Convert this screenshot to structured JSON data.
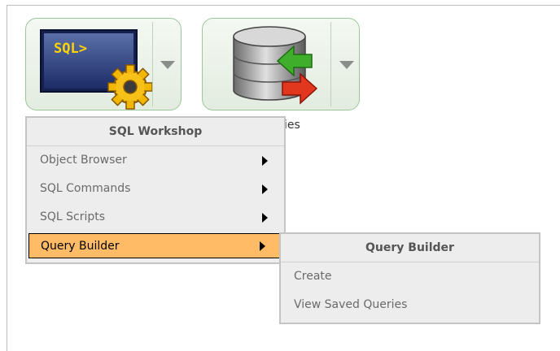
{
  "tiles": [
    {
      "name": "sql-workshop-tile",
      "icon": "sql-prompt-gear-icon",
      "caption": ""
    },
    {
      "name": "utilities-tile",
      "icon": "database-transfer-icon",
      "caption": "ies"
    }
  ],
  "sql_icon_text": "SQL>",
  "menu": {
    "title": "SQL Workshop",
    "items": [
      {
        "label": "Object Browser"
      },
      {
        "label": "SQL Commands"
      },
      {
        "label": "SQL Scripts"
      },
      {
        "label": "Query Builder"
      }
    ],
    "active_index": 3
  },
  "submenu": {
    "title": "Query Builder",
    "items": [
      {
        "label": "Create"
      },
      {
        "label": "View Saved Queries"
      }
    ]
  },
  "colors": {
    "active_item": "#ffbb66",
    "tile_border": "#9bc79a"
  }
}
